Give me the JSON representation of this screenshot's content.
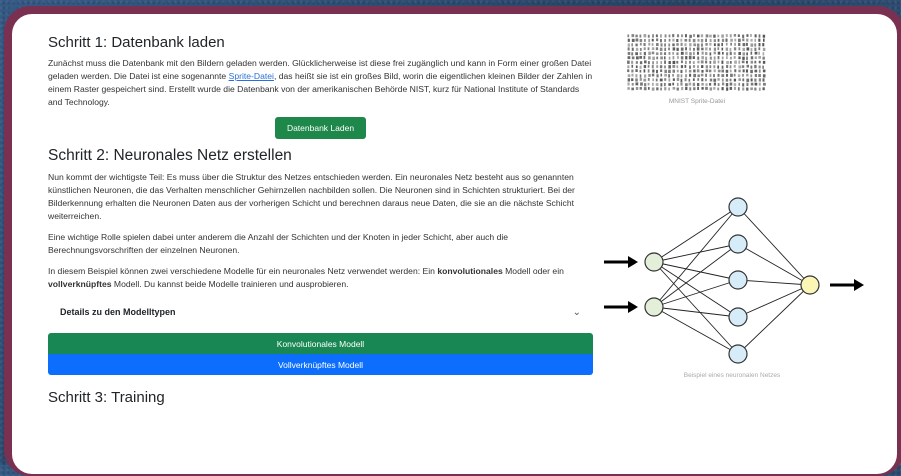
{
  "step1": {
    "title": "Schritt 1: Datenbank laden",
    "text_before_link": "Zunächst muss die Datenbank mit den Bildern geladen werden. Glücklicherweise ist diese frei zugänglich und kann in Form einer großen Datei geladen werden. Die Datei ist eine sogenannte ",
    "link": "Sprite-Datei",
    "text_after_link": ", das heißt sie ist ein großes Bild, worin die eigentlichen kleinen Bilder der Zahlen in einem Raster gespeichert sind. Erstellt wurde die Datenbank von der amerikanischen Behörde NIST, kurz für National Institute of Standards and Technology.",
    "load_button": "Datenbank Laden",
    "image_caption": "MNIST Sprite-Datei"
  },
  "step2": {
    "title": "Schritt 2: Neuronales Netz erstellen",
    "para1": "Nun kommt der wichtigste Teil: Es muss über die Struktur des Netzes entschieden werden. Ein neuronales Netz besteht aus so genannten künstlichen Neuronen, die das Verhalten menschlicher Gehirnzellen nachbilden sollen. Die Neuronen sind in Schichten strukturiert. Bei der Bilderkennung erhalten die Neuronen Daten aus der vorherigen Schicht und berechnen daraus neue Daten, die sie an die nächste Schicht weiterreichen.",
    "para2": "Eine wichtige Rolle spielen dabei unter anderem die Anzahl der Schichten und der Knoten in jeder Schicht, aber auch die Berechnungsvorschriften der einzelnen Neuronen.",
    "para3_pre": "In diesem Beispiel können zwei verschiedene Modelle für ein neuronales Netz verwendet werden: Ein ",
    "para3_bold1": "konvolutionales",
    "para3_mid": " Modell oder ein ",
    "para3_bold2": "vollverknüpftes",
    "para3_post": " Modell. Du kannst beide Modelle trainieren und ausprobieren.",
    "accordion_label": "Details zu den Modelltypen",
    "conv_button": "Konvolutionales Modell",
    "dense_button": "Vollverknüpftes Modell",
    "diagram_caption": "Beispiel eines neuronalen Netzes"
  },
  "step3": {
    "title": "Schritt 3: Training"
  },
  "colors": {
    "input_node": "#e3efd8",
    "hidden_node": "#d6ecf8",
    "output_node": "#fbf6b5"
  }
}
